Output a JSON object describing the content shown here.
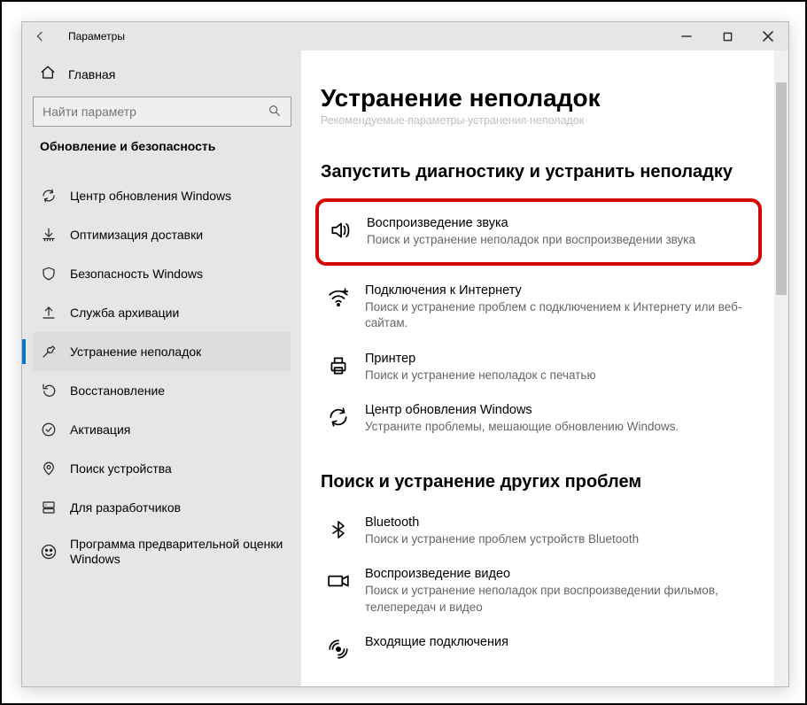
{
  "window": {
    "title": "Параметры"
  },
  "sidebar": {
    "home": "Главная",
    "search_placeholder": "Найти параметр",
    "section": "Обновление и безопасность",
    "items": [
      {
        "label": "Центр обновления Windows"
      },
      {
        "label": "Оптимизация доставки"
      },
      {
        "label": "Безопасность Windows"
      },
      {
        "label": "Служба архивации"
      },
      {
        "label": "Устранение неполадок"
      },
      {
        "label": "Восстановление"
      },
      {
        "label": "Активация"
      },
      {
        "label": "Поиск устройства"
      },
      {
        "label": "Для разработчиков"
      },
      {
        "label": "Программа предварительной оценки Windows"
      }
    ]
  },
  "main": {
    "title": "Устранение неполадок",
    "recommended_hint": "Рекомендуемые параметры устранения неполадок",
    "section1": "Запустить диагностику и устранить неполадку",
    "section2": "Поиск и устранение других проблем",
    "items1": [
      {
        "title": "Воспроизведение звука",
        "desc": "Поиск и устранение неполадок при воспроизведении звука"
      },
      {
        "title": "Подключения к Интернету",
        "desc": "Поиск и устранение проблем с подключением к Интернету или веб-сайтам."
      },
      {
        "title": "Принтер",
        "desc": "Поиск и устранение неполадок с печатью"
      },
      {
        "title": "Центр обновления Windows",
        "desc": "Устраните проблемы, мешающие обновлению Windows."
      }
    ],
    "items2": [
      {
        "title": "Bluetooth",
        "desc": "Поиск и устранение проблем устройств Bluetooth"
      },
      {
        "title": "Воспроизведение видео",
        "desc": "Поиск и устранение неполадок при воспроизведении фильмов, телепередач и видео"
      },
      {
        "title": "Входящие подключения",
        "desc": ""
      }
    ]
  }
}
